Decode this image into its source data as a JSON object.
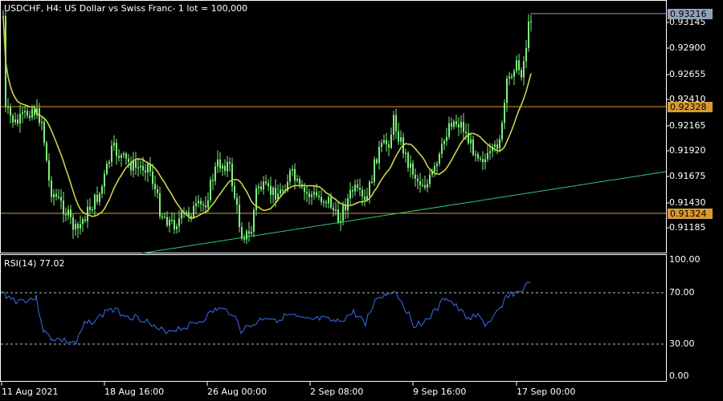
{
  "header": {
    "title": "USDCHF, H4:  US Dollar vs Swiss Franc- 1 lot = 100,000"
  },
  "rsi": {
    "label": "RSI(14) 77.02",
    "levels": [
      "100.00",
      "70.00",
      "30.00",
      "0.00"
    ]
  },
  "price_axis": {
    "labels": [
      "0.93145",
      "0.92900",
      "0.92655",
      "0.92410",
      "0.92165",
      "0.91920",
      "0.91675",
      "0.91430",
      "0.91185"
    ],
    "current_price": "0.93216",
    "level_high": "0.92328",
    "level_low": "0.91324"
  },
  "time_axis": {
    "labels": [
      "11 Aug 2021",
      "18 Aug 16:00",
      "26 Aug 00:00",
      "2 Sep 08:00",
      "9 Sep 16:00",
      "17 Sep 00:00"
    ]
  },
  "colors": {
    "background": "#000000",
    "candles": "#7ef07e",
    "moving_average": "#c9d64a",
    "trendline": "#2ecc71",
    "horizontal_levels": "#d89a30",
    "rsi_line": "#3b6cf0",
    "grid_frame": "#ffffff",
    "current_price_line": "#8fa3b8"
  }
}
